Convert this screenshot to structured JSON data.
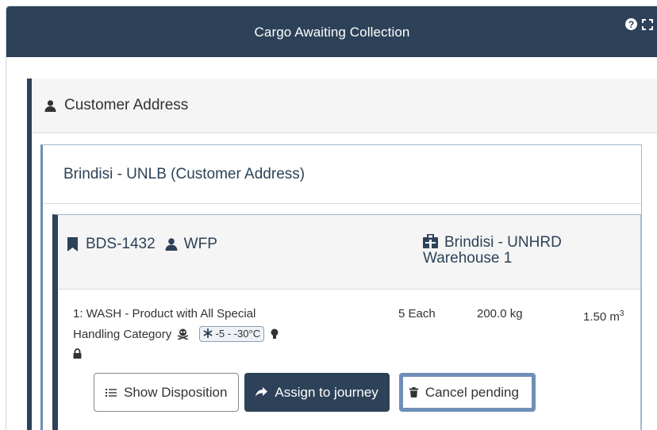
{
  "panel": {
    "title": "Cargo Awaiting Collection",
    "help_glyph": "?"
  },
  "group": {
    "label": "Customer Address",
    "location": {
      "label": "Brindisi - UNLB (Customer Address)",
      "shipment": {
        "id": "BDS-1432",
        "customer": "WFP",
        "destination_line1": "Brindisi - UNHRD",
        "destination_line2": "Warehouse 1",
        "item": {
          "desc_line1": "1: WASH - Product with All Special",
          "desc_line2": "Handling Category",
          "temperature": "-5 - -30°C",
          "quantity": "5 Each",
          "weight": "200.0 kg",
          "volume": "1.50 m",
          "volume_unit_sup": "3"
        },
        "actions": {
          "show_disposition": "Show Disposition",
          "assign": "Assign to journey",
          "cancel": "Cancel pending"
        }
      }
    }
  },
  "colors": {
    "header_bg": "#2d4258",
    "accent_border": "#6f8fb8",
    "muted_bg": "#f5f5f5"
  },
  "icons": [
    "help-icon",
    "expand-icon",
    "user-icon",
    "bookmark-icon",
    "warehouse-icon",
    "skull-icon",
    "snowflake-icon",
    "lightbulb-icon",
    "lock-icon",
    "list-icon",
    "share-arrow-icon",
    "trash-icon"
  ]
}
